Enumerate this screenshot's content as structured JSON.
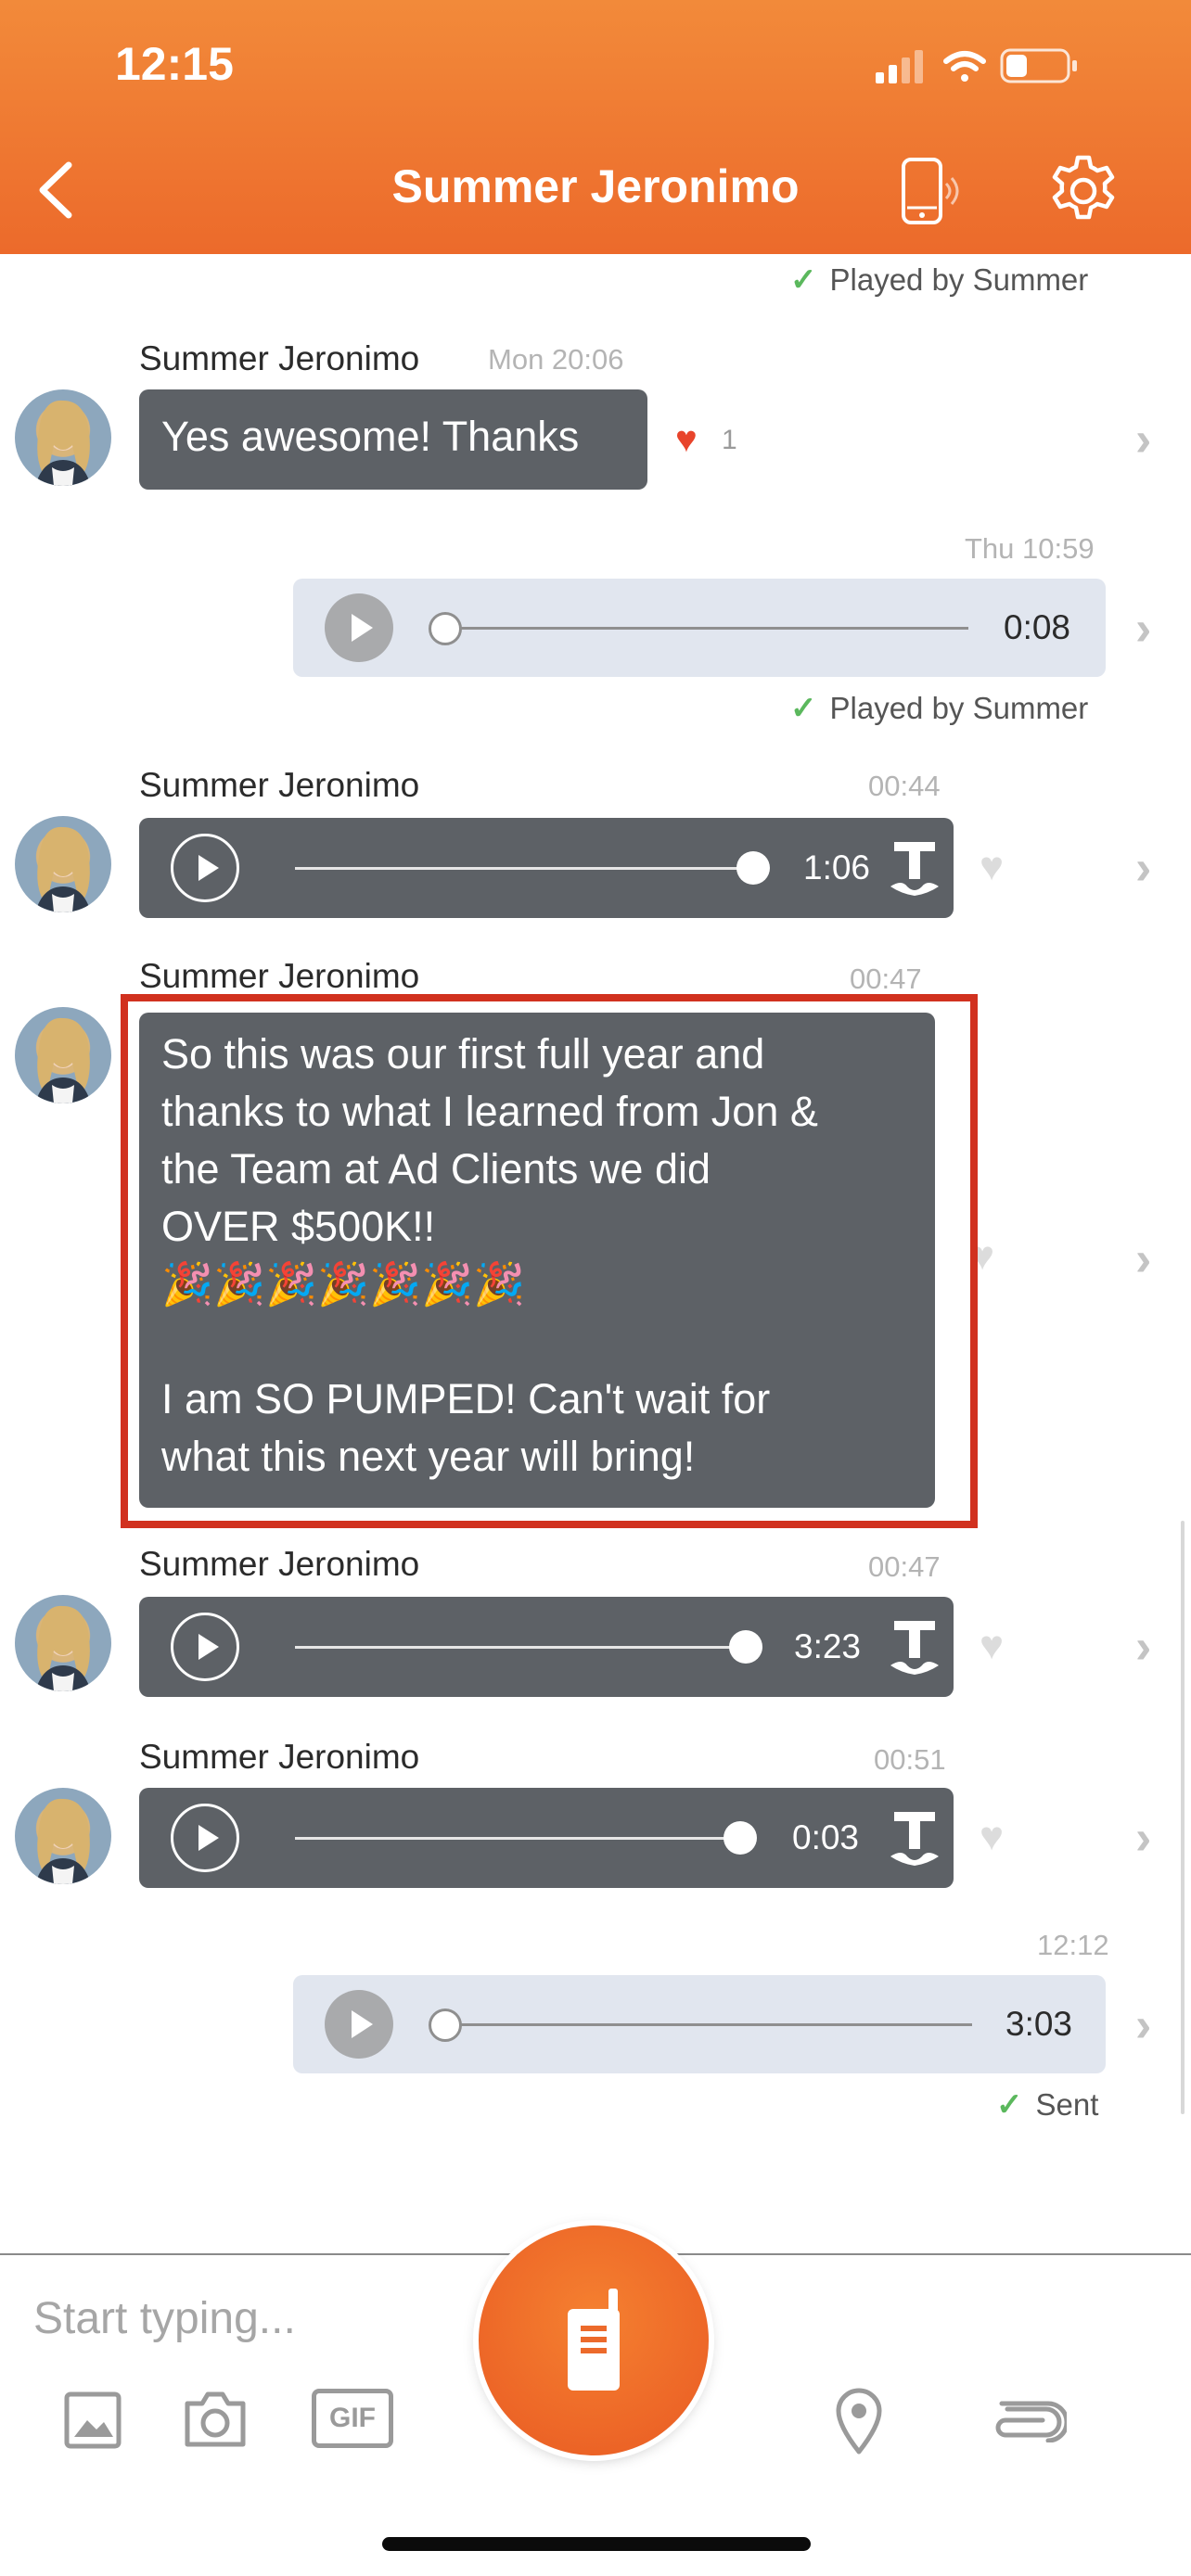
{
  "status_bar": {
    "time": "12:15"
  },
  "header": {
    "title": "Summer Jeronimo"
  },
  "messages": {
    "m0": {
      "receipt": "Played by Summer"
    },
    "m1": {
      "sender": "Summer Jeronimo",
      "time": "Mon 20:06",
      "text": "Yes awesome! Thanks",
      "reaction_count": "1"
    },
    "m2": {
      "time": "Thu 10:59",
      "duration": "0:08",
      "receipt": "Played by Summer"
    },
    "m3": {
      "sender": "Summer Jeronimo",
      "time": "00:44",
      "duration": "1:06"
    },
    "m4": {
      "sender": "Summer Jeronimo",
      "time": "00:47",
      "text": "So this was our first full year and\nthanks to what I learned from Jon &\nthe Team at Ad Clients we did\nOVER $500K!!\n🎉🎉🎉🎉🎉🎉🎉\n\nI am SO PUMPED! Can't wait for\nwhat this next year will bring!"
    },
    "m5": {
      "sender": "Summer Jeronimo",
      "time": "00:47",
      "duration": "3:23"
    },
    "m6": {
      "sender": "Summer Jeronimo",
      "time": "00:51",
      "duration": "0:03"
    },
    "m7": {
      "time": "12:12",
      "duration": "3:03",
      "receipt": "Sent"
    }
  },
  "composer": {
    "placeholder": "Start typing...",
    "gif_label": "GIF"
  },
  "colors": {
    "brand_orange": "#ec6a2b",
    "dark_bubble": "#5d6166",
    "light_bubble": "#e1e6ef",
    "highlight": "#d1311f",
    "reaction_heart": "#e8442b",
    "check_green": "#5bb85d"
  }
}
